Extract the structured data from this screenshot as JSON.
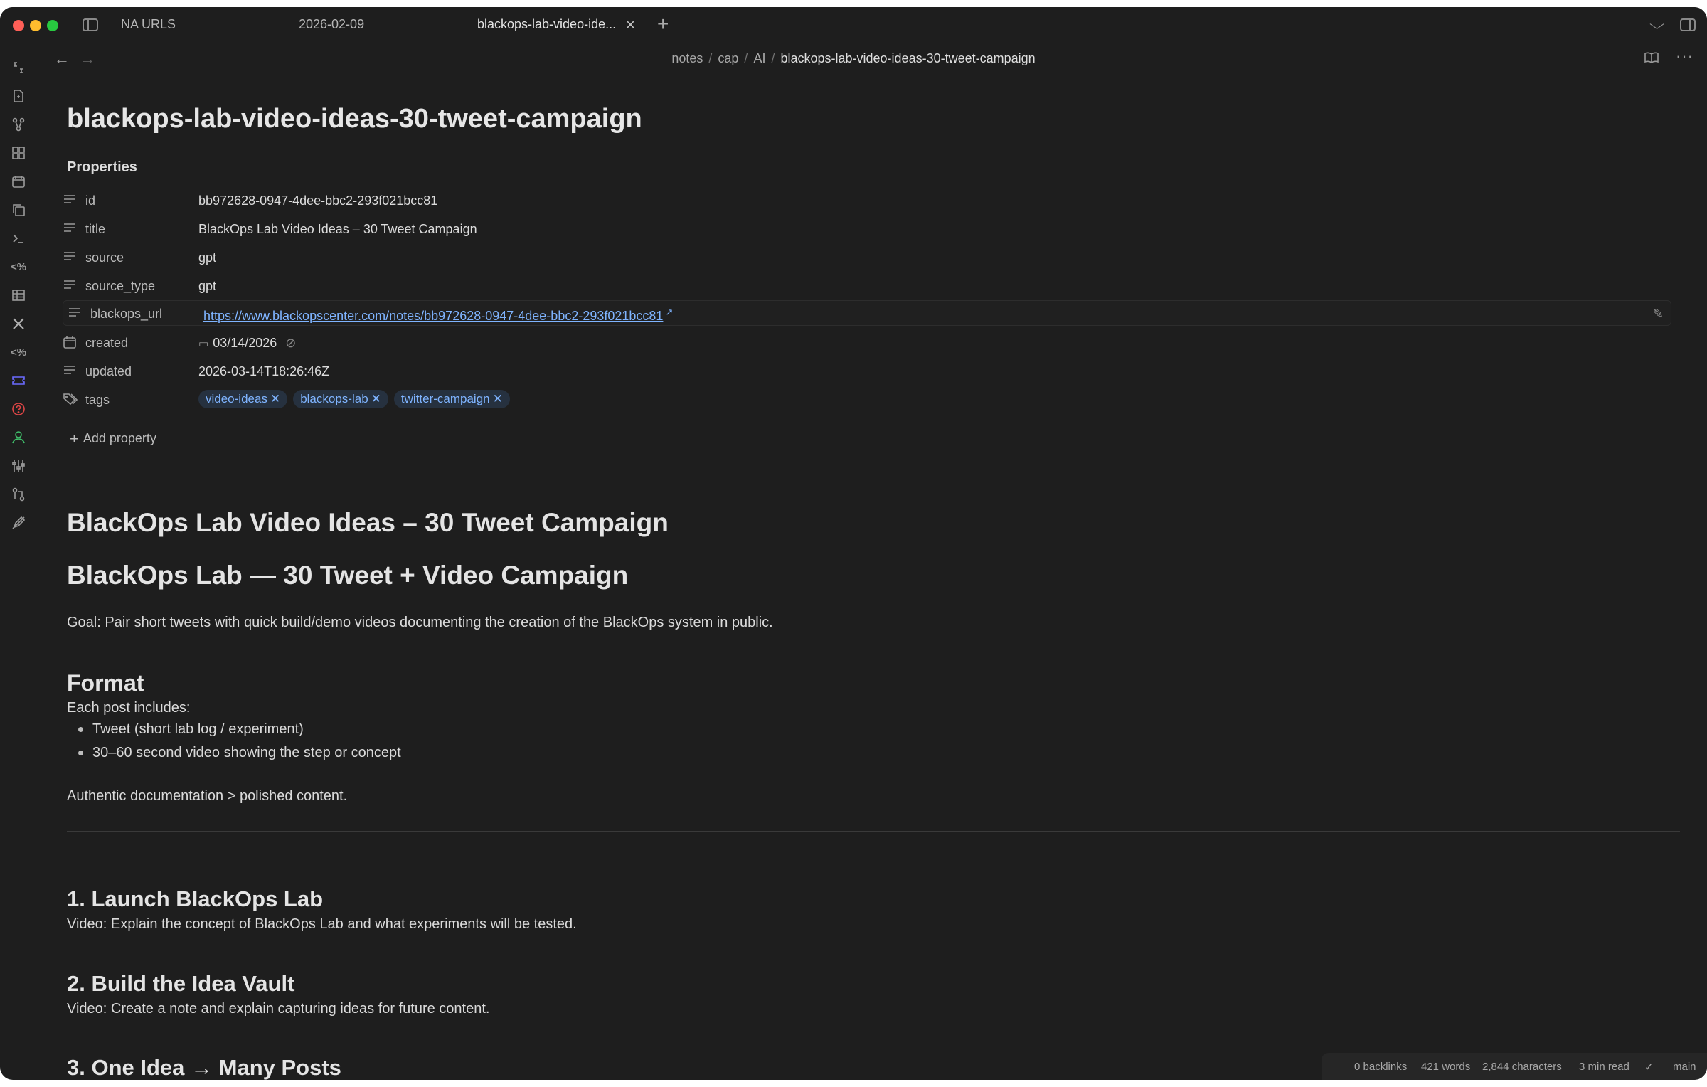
{
  "tabs": [
    {
      "label": "NA URLS"
    },
    {
      "label": "2026-02-09"
    },
    {
      "label": "blackops-lab-video-ide..."
    }
  ],
  "breadcrumb": {
    "parts": [
      "notes",
      "cap",
      "AI"
    ],
    "current": "blackops-lab-video-ideas-30-tweet-campaign",
    "separator": "/"
  },
  "note": {
    "title": "blackops-lab-video-ideas-30-tweet-campaign",
    "properties_heading": "Properties",
    "properties": [
      {
        "key": "id",
        "value": "bb972628-0947-4dee-bbc2-293f021bcc81"
      },
      {
        "key": "title",
        "value": "BlackOps Lab Video Ideas – 30 Tweet Campaign"
      },
      {
        "key": "source",
        "value": "gpt"
      },
      {
        "key": "source_type",
        "value": "gpt"
      },
      {
        "key": "blackops_url",
        "value": "https://www.blackopscenter.com/notes/bb972628-0947-4dee-bbc2-293f021bcc81"
      },
      {
        "key": "created",
        "value": "03/14/2026"
      },
      {
        "key": "updated",
        "value": "2026-03-14T18:26:46Z"
      },
      {
        "key": "tags"
      }
    ],
    "tags": [
      "video-ideas",
      "blackops-lab",
      "twitter-campaign"
    ],
    "add_property": "Add property"
  },
  "content": {
    "h1_a": "BlackOps Lab Video Ideas – 30 Tweet Campaign",
    "h1_b": "BlackOps Lab — 30 Tweet + Video Campaign",
    "goal": "Goal: Pair short tweets with quick build/demo videos documenting the creation of the BlackOps system in public.",
    "format_heading": "Format",
    "format_intro": "Each post includes:",
    "format_items": [
      "Tweet (short lab log / experiment)",
      "30–60 second video showing the step or concept"
    ],
    "authentic": "Authentic documentation > polished content.",
    "sections": [
      {
        "heading": "1. Launch BlackOps Lab",
        "text": "Video: Explain the concept of BlackOps Lab and what experiments will be tested."
      },
      {
        "heading": "2. Build the Idea Vault",
        "text": "Video: Create a note and explain capturing ideas for future content."
      },
      {
        "heading": "3. One Idea → Many Posts"
      }
    ]
  },
  "status": {
    "backlinks": "0 backlinks",
    "words": "421 words",
    "characters": "2,844 characters",
    "read_time": "3 min read",
    "branch": "main"
  },
  "colors": {
    "background": "#1e1e1e",
    "accent_link": "#7fb4ff",
    "tag_bg": "#26313f"
  }
}
